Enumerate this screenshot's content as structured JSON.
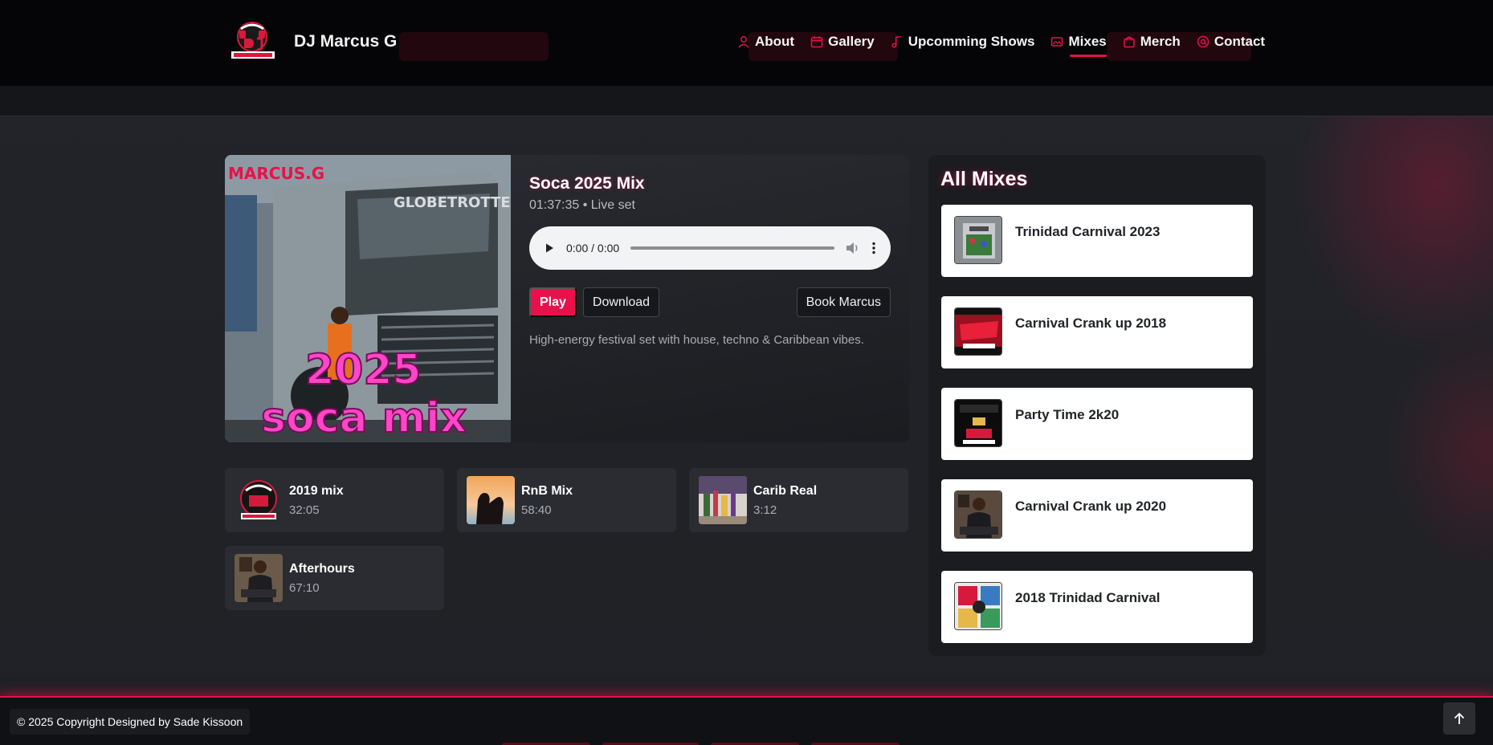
{
  "brand": {
    "name": "DJ Marcus G"
  },
  "nav": [
    {
      "label": "About",
      "icon": "user-icon"
    },
    {
      "label": "Gallery",
      "icon": "calendar-icon"
    },
    {
      "label": "Upcomming Shows",
      "icon": "music-note-icon"
    },
    {
      "label": "Mixes",
      "icon": "image-icon",
      "active": true
    },
    {
      "label": "Merch",
      "icon": "shopping-bag-icon"
    },
    {
      "label": "Contact",
      "icon": "at-sign-icon"
    }
  ],
  "player": {
    "title": "Soca 2025 Mix",
    "meta": "01:37:35 • Live set",
    "audio_time": "0:00 / 0:00",
    "play_label": "Play",
    "download_label": "Download",
    "book_label": "Book Marcus",
    "description": "High-energy festival set with house, techno & Caribbean vibes.",
    "cover_text": {
      "logo": "MARCUS.G",
      "line1": "2025",
      "line2": "soca mix"
    }
  },
  "tiles": [
    {
      "title": "2019 mix",
      "duration": "32:05"
    },
    {
      "title": "RnB Mix",
      "duration": "58:40"
    },
    {
      "title": "Carib Real",
      "duration": "3:12"
    },
    {
      "title": "Afterhours",
      "duration": "67:10"
    }
  ],
  "all_mixes": {
    "title": "All Mixes",
    "items": [
      {
        "title": "Trinidad Carnival 2023"
      },
      {
        "title": "Carnival Crank up 2018"
      },
      {
        "title": "Party Time 2k20"
      },
      {
        "title": "Carnival Crank up 2020"
      },
      {
        "title": "2018 Trinidad Carnival"
      }
    ]
  },
  "footer": {
    "copyright": "© 2025 Copyright Designed by Sade Kissoon"
  },
  "colors": {
    "accent": "#e8114b",
    "background": "#202226",
    "header": "#050507"
  }
}
